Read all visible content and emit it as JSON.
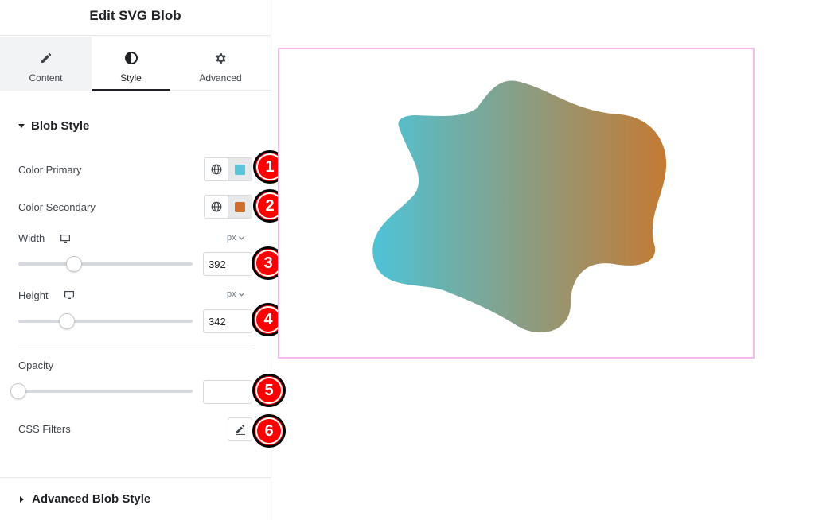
{
  "panel": {
    "title": "Edit SVG Blob",
    "tabs": [
      {
        "label": "Content",
        "icon": "pencil-icon",
        "active": false
      },
      {
        "label": "Style",
        "icon": "contrast-icon",
        "active": true
      },
      {
        "label": "Advanced",
        "icon": "gear-icon",
        "active": false
      }
    ]
  },
  "blob_style": {
    "title": "Blob Style",
    "color_primary": {
      "label": "Color Primary",
      "value": "#5bc4d8"
    },
    "color_secondary": {
      "label": "Color Secondary",
      "value": "#cc6e2e"
    },
    "width": {
      "label": "Width",
      "unit": "px",
      "value": "392",
      "slider_fraction": 0.32
    },
    "height": {
      "label": "Height",
      "unit": "px",
      "value": "342",
      "slider_fraction": 0.28
    },
    "opacity": {
      "label": "Opacity",
      "value": "",
      "slider_fraction": 0.0
    },
    "css_filters": {
      "label": "CSS Filters"
    }
  },
  "advanced_blob_style": {
    "title": "Advanced Blob Style"
  },
  "markers": [
    "1",
    "2",
    "3",
    "4",
    "5",
    "6"
  ],
  "colors": {
    "blob_gradient_start": "#4ec3d6",
    "blob_gradient_end": "#c47a33",
    "canvas_border": "#f4b8ee",
    "marker_fill": "#ff0000"
  }
}
